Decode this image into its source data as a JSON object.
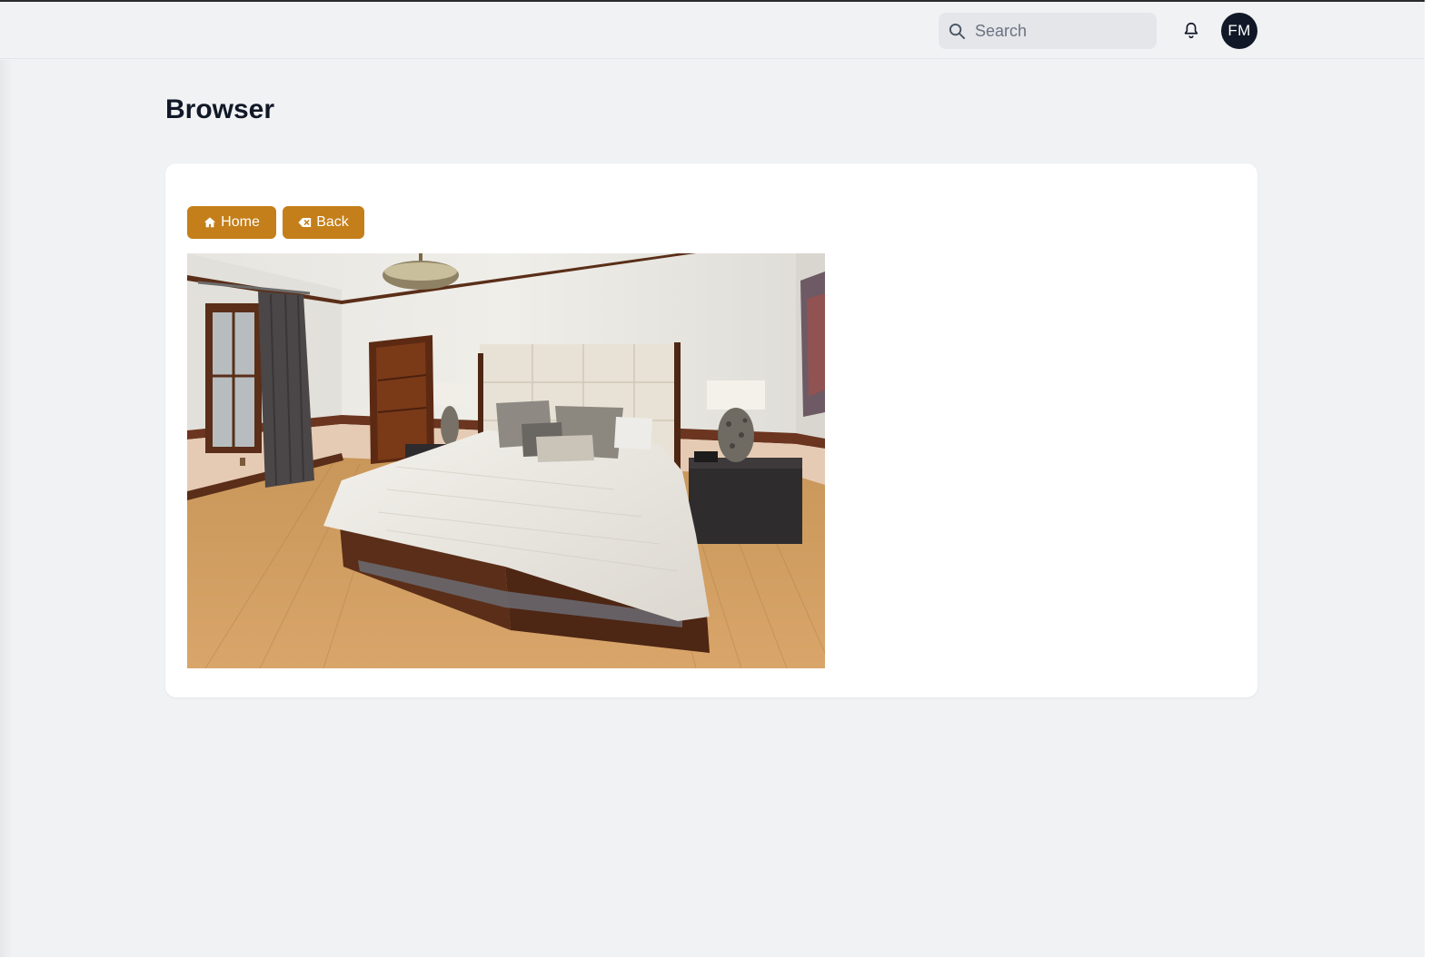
{
  "header": {
    "search_placeholder": "Search",
    "avatar_initials": "FM"
  },
  "page": {
    "title": "Browser"
  },
  "toolbar": {
    "home_label": "Home",
    "back_label": "Back"
  },
  "colors": {
    "accent": "#c47f1a",
    "avatar_bg": "#111827"
  }
}
